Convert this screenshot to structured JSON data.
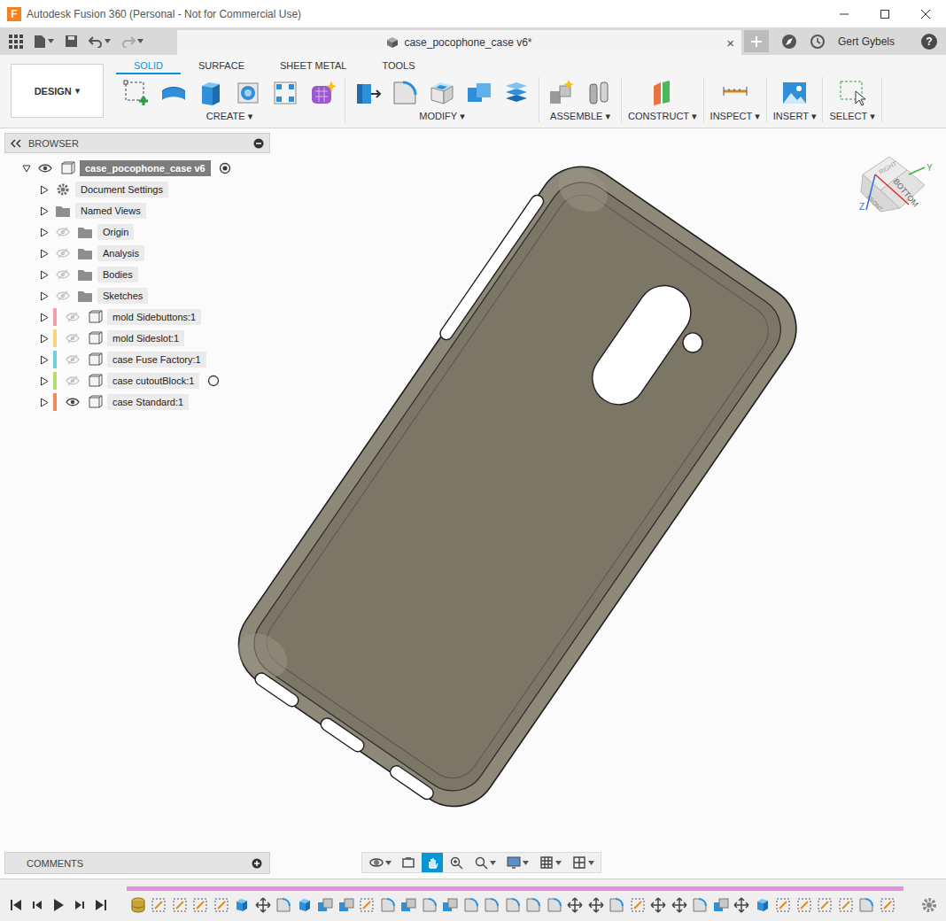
{
  "window": {
    "logo": "F",
    "title": "Autodesk Fusion 360 (Personal - Not for Commercial Use)"
  },
  "document_tab": {
    "title": "case_pocophone_case v6*",
    "close": "×",
    "selected": true
  },
  "user": "Gert Gybels",
  "help": "?",
  "workspace": {
    "label": "DESIGN",
    "caret": "▾"
  },
  "toolbar_tabs": [
    {
      "label": "SOLID",
      "selected": true
    },
    {
      "label": "SURFACE",
      "selected": false
    },
    {
      "label": "SHEET METAL",
      "selected": false
    },
    {
      "label": "TOOLS",
      "selected": false
    }
  ],
  "tool_groups": [
    {
      "label": "CREATE",
      "caret": "▾",
      "tools": [
        "sketch",
        "form",
        "extrude",
        "revolve",
        "pattern",
        "freeform"
      ]
    },
    {
      "label": "MODIFY",
      "caret": "▾",
      "tools": [
        "press-pull",
        "fillet",
        "shell",
        "combine",
        "offset"
      ]
    },
    {
      "label": "ASSEMBLE",
      "caret": "▾",
      "tools": [
        "new-component",
        "joint"
      ]
    },
    {
      "label": "CONSTRUCT",
      "caret": "▾",
      "tools": [
        "plane"
      ]
    },
    {
      "label": "INSPECT",
      "caret": "▾",
      "tools": [
        "measure"
      ]
    },
    {
      "label": "INSERT",
      "caret": "▾",
      "tools": [
        "image"
      ]
    },
    {
      "label": "SELECT",
      "caret": "▾",
      "tools": [
        "select"
      ]
    }
  ],
  "browser": {
    "title": "BROWSER",
    "root": {
      "label": "case_pocophone_case v6",
      "visible": true,
      "expanded": true,
      "activate_marker": true,
      "active": true
    },
    "items": [
      {
        "label": "Document Settings",
        "kind": "settings",
        "visible": false,
        "expanded": false,
        "activate_marker": false,
        "active": false
      },
      {
        "label": "Named Views",
        "kind": "views",
        "visible": false,
        "expanded": false,
        "activate_marker": false,
        "active": false
      },
      {
        "label": "Origin",
        "kind": "folder",
        "visible": false,
        "expanded": false,
        "activate_marker": false,
        "active": false
      },
      {
        "label": "Analysis",
        "kind": "folder",
        "visible": false,
        "expanded": false,
        "activate_marker": false,
        "active": false
      },
      {
        "label": "Bodies",
        "kind": "folder",
        "visible": false,
        "expanded": false,
        "activate_marker": false,
        "active": false
      },
      {
        "label": "Sketches",
        "kind": "folder",
        "visible": false,
        "expanded": false,
        "activate_marker": false,
        "active": false
      },
      {
        "label": "mold Sidebuttons:1",
        "kind": "component",
        "visible": false,
        "expanded": false,
        "activate_marker": false,
        "active": false,
        "color": "#f2a0ab"
      },
      {
        "label": "mold Sideslot:1",
        "kind": "component",
        "visible": false,
        "expanded": false,
        "activate_marker": false,
        "active": false,
        "color": "#f6d67a"
      },
      {
        "label": "case Fuse Factory:1",
        "kind": "component",
        "visible": false,
        "expanded": false,
        "activate_marker": false,
        "active": false,
        "color": "#6fd0dd"
      },
      {
        "label": "case cutoutBlock:1",
        "kind": "component",
        "visible": false,
        "expanded": false,
        "activate_marker": true,
        "active": false,
        "color": "#b5df6c"
      },
      {
        "label": "case Standard:1",
        "kind": "component",
        "visible": true,
        "expanded": false,
        "activate_marker": false,
        "active": false,
        "color": "#f08a5c"
      }
    ]
  },
  "viewcube": {
    "top": "RIGHT",
    "front": "BOTTOM",
    "side": "FRONT",
    "axes": [
      {
        "label": "Y",
        "color": "#3fb54a"
      },
      {
        "label": "Z",
        "color": "#3f6fd6"
      }
    ]
  },
  "comments": {
    "title": "COMMENTS"
  },
  "nav_tools": [
    {
      "kind": "orbit",
      "dropdown": true,
      "selected": false
    },
    {
      "kind": "look-at",
      "dropdown": false,
      "selected": false
    },
    {
      "kind": "pan",
      "dropdown": false,
      "selected": true
    },
    {
      "kind": "zoom",
      "dropdown": false,
      "selected": false
    },
    {
      "kind": "zoom-fit",
      "dropdown": true,
      "selected": false
    },
    {
      "kind": "display",
      "dropdown": true,
      "selected": false
    },
    {
      "kind": "grid",
      "dropdown": true,
      "selected": false
    },
    {
      "kind": "viewports",
      "dropdown": true,
      "selected": false
    }
  ],
  "timeline": {
    "controls": [
      "first",
      "previous",
      "play",
      "next",
      "last"
    ],
    "features": [
      "component",
      "sketch",
      "sketch",
      "sketch",
      "sketch",
      "extrude",
      "move",
      "fillet",
      "extrude",
      "combine",
      "combine",
      "sketch",
      "fillet",
      "combine",
      "fillet",
      "combine",
      "fillet",
      "fillet",
      "fillet",
      "fillet",
      "fillet",
      "move",
      "move",
      "fillet",
      "sketch",
      "move",
      "move",
      "fillet",
      "combine",
      "move",
      "extrude",
      "sketch",
      "sketch",
      "sketch",
      "sketch",
      "fillet",
      "sketch"
    ]
  }
}
